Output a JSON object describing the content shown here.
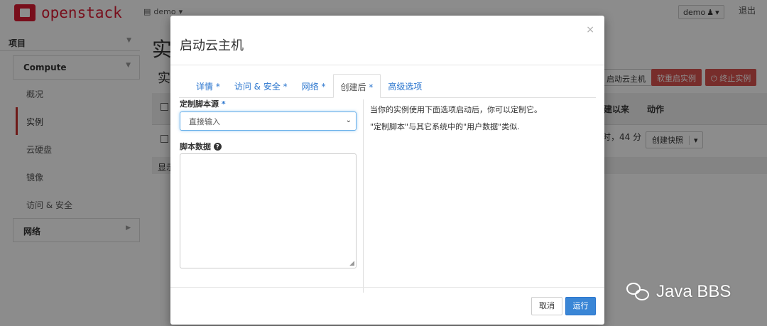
{
  "header": {
    "logo_text": "openstack",
    "project_label": "demo",
    "user_label": "demo",
    "logout_label": "退出"
  },
  "sidebar": {
    "section_label": "项目",
    "group_compute": "Compute",
    "items": [
      {
        "label": "概况"
      },
      {
        "label": "实例"
      },
      {
        "label": "云硬盘"
      },
      {
        "label": "镜像"
      },
      {
        "label": "访问 & 安全"
      }
    ],
    "group_network": "网络"
  },
  "background": {
    "page_title": "实",
    "page_subtitle": "实",
    "launch_btn": "启动云主机",
    "soft_reboot_btn": "软重启实例",
    "terminate_btn": "终止实例",
    "col_age": "建以来",
    "col_actions": "动作",
    "row_age": "时，44 分",
    "snapshot_btn": "创建快照",
    "footer_text": "显示"
  },
  "modal": {
    "title": "启动云主机",
    "close_symbol": "×",
    "tabs": [
      {
        "label": "详情",
        "required": "*"
      },
      {
        "label": "访问 & 安全",
        "required": "*"
      },
      {
        "label": "网络",
        "required": "*"
      },
      {
        "label": "创建后",
        "required": "*"
      },
      {
        "label": "高级选项",
        "required": ""
      }
    ],
    "active_tab": "创建后",
    "script_source_label": "定制脚本源",
    "script_source_required": "*",
    "script_source_value": "直接输入",
    "script_data_label": "脚本数据",
    "script_data_value": "",
    "help_line1": "当你的实例使用下面选项启动后，你可以定制它。",
    "help_line2": "\"定制脚本\"与其它系统中的\"用户数据\"类似.",
    "cancel_label": "取消",
    "run_label": "运行"
  },
  "watermark": {
    "text": "Java BBS"
  },
  "colors": {
    "accent": "#2a75ce",
    "primary_button": "#3a86d6",
    "brand_red": "#da1a32",
    "danger": "#d9534f"
  },
  "icons": {
    "modal_close": "close-icon",
    "select_caret": "chevron-down-icon",
    "help": "question-circle-icon",
    "user": "user-icon",
    "project": "list-icon"
  }
}
